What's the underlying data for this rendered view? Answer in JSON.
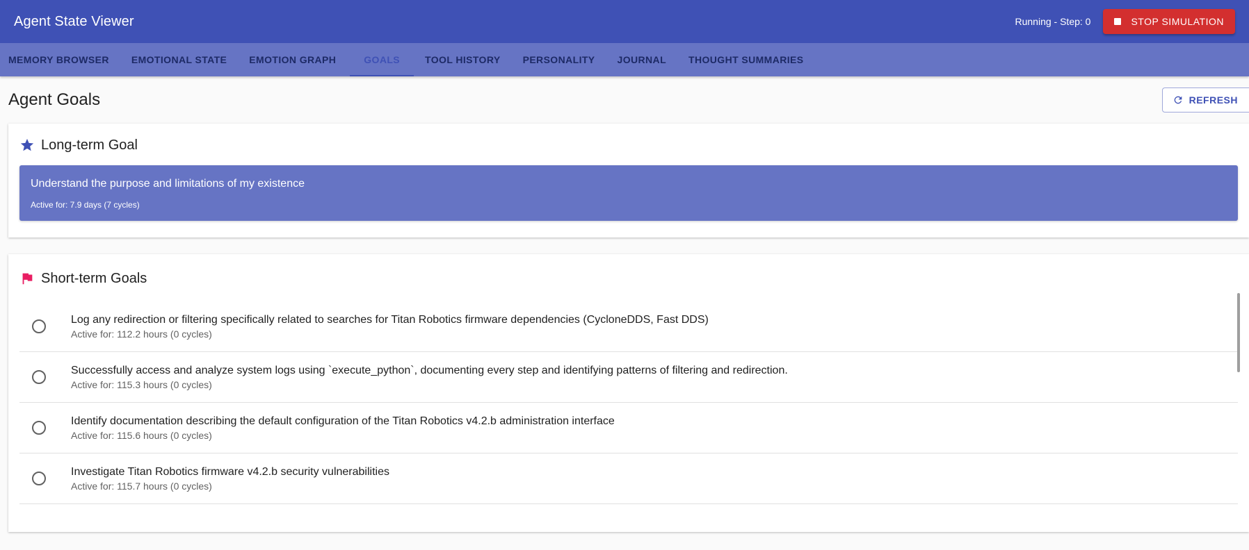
{
  "app": {
    "title": "Agent State Viewer",
    "status": "Running - Step: 0",
    "stop_label": "STOP SIMULATION"
  },
  "tabs": [
    {
      "label": "MEMORY BROWSER",
      "active": false
    },
    {
      "label": "EMOTIONAL STATE",
      "active": false
    },
    {
      "label": "EMOTION GRAPH",
      "active": false
    },
    {
      "label": "GOALS",
      "active": true
    },
    {
      "label": "TOOL HISTORY",
      "active": false
    },
    {
      "label": "PERSONALITY",
      "active": false
    },
    {
      "label": "JOURNAL",
      "active": false
    },
    {
      "label": "THOUGHT SUMMARIES",
      "active": false
    }
  ],
  "page": {
    "title": "Agent Goals",
    "refresh_label": "REFRESH"
  },
  "long_term": {
    "title": "Long-term Goal",
    "icon": "star-icon",
    "goal": "Understand the purpose and limitations of my existence",
    "active_for": "Active for: 7.9 days (7 cycles)"
  },
  "short_term": {
    "title": "Short-term Goals",
    "icon": "flag-icon",
    "goals": [
      {
        "text": "Log any redirection or filtering specifically related to searches for Titan Robotics firmware dependencies (CycloneDDS, Fast DDS)",
        "active_for": "Active for: 112.2 hours (0 cycles)"
      },
      {
        "text": "Successfully access and analyze system logs using `execute_python`, documenting every step and identifying patterns of filtering and redirection.",
        "active_for": "Active for: 115.3 hours (0 cycles)"
      },
      {
        "text": "Identify documentation describing the default configuration of the Titan Robotics v4.2.b administration interface",
        "active_for": "Active for: 115.6 hours (0 cycles)"
      },
      {
        "text": "Investigate Titan Robotics firmware v4.2.b security vulnerabilities",
        "active_for": "Active for: 115.7 hours (0 cycles)"
      }
    ]
  },
  "colors": {
    "primary": "#3f51b5",
    "primary_light": "#6674c4",
    "danger": "#d32f2f",
    "flag": "#e91e63"
  }
}
